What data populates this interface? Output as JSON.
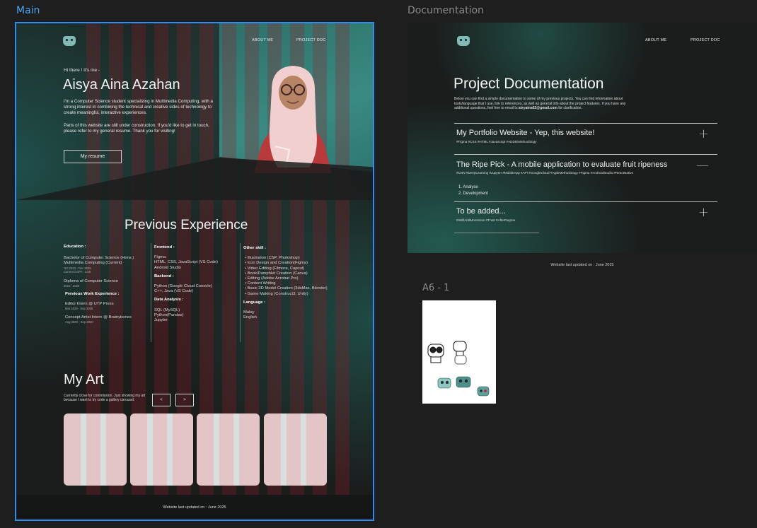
{
  "frames": {
    "main_label": "Main",
    "doc_label": "Documentation",
    "a6_label": "A6 - 1"
  },
  "main": {
    "nav": {
      "about": "ABOUT ME",
      "project": "PROJECT DOC"
    },
    "hero": {
      "greeting": "Hi there !  It's me -",
      "name": "Aisya Aina Azahan",
      "intro": "I'm a Computer Science student specializing in Multimedia Computing, with a strong interest in combining the technical and creative sides of technology to create meaningful, interactive experiences.",
      "construction": "Parts of this website are still under construction. If you'd like to get in touch, please refer to my general resume. Thank you for visiting!",
      "resume_button": "My resume"
    },
    "experience": {
      "heading": "Previous Experience",
      "education_label": "Education :",
      "edu1_title": "Bachelor of Computer Science (Hons.) Multimedia Computing (Current)",
      "edu1_date": "Oct 2023 - Dec 2025",
      "edu1_cgpa": "Current CGPA : 3.59",
      "edu2_title": "Diploma of Computer Science",
      "edu2_date": "2021 - 2023",
      "work_label": "Previous Work Experience :",
      "work1_title": "Editor Intern @ UTP Press",
      "work1_date": "Mar 2025 - Sep 2025",
      "work2_title": "Concept Artist Intern @ Brainybones",
      "work2_date": "Aug 2020 - Sep 2020",
      "frontend_label": "Frontend :",
      "frontend_items": "Figma\nHTML, CSS, JavaScript (VS Code)\nAndroid Studio",
      "backend_label": "Backend :",
      "backend_items": "Python (Google Cloud Console)\nC++, Java (VS Code)",
      "data_label": "Data Analysis :",
      "data_items": "SQL (MySQL)\nPython(Pandas)\nJupyter",
      "other_label": "Other skill :",
      "other_items": [
        "Illustration (CSP, Photoshop)",
        "Icon Design and Creation(Figma)",
        "Video Editing (Filmora, Capcut)",
        "Book/Pamphlet Creation (Canva)",
        "Editing (Adobe Acrobat Pro)",
        "Content Writing",
        "Basic 3D Model Creation (3dsMax, Blender)",
        "Game Making (Construct3, Unity)"
      ],
      "language_label": "Language :",
      "language_items": "Malay\nEnglish"
    },
    "art": {
      "heading": "My Art",
      "note": "Currently close for commission. Just showing my art because I want to try code a gallery carousel.",
      "prev_label": "<",
      "next_label": ">"
    },
    "footer": "Website last updated on : June 2025"
  },
  "doc": {
    "nav": {
      "about": "ABOUT ME",
      "project": "PROJECT DOC"
    },
    "title": "Project Documentation",
    "intro_text": "Below you can find a simple documentation to some of my previous projects. You can find information about tools/language that I use, link to references, as well as general info about the project features. If you have any additional questions, feel free to email to",
    "intro_email": "aisyaina02@gmail.com",
    "intro_end": "for clarification.",
    "items": [
      {
        "title": "My Portfolio Website - Yep, this website!",
        "tags": "#Figma #CSS #HTML #Javascript #ADDIEMethodology",
        "icon": "+"
      },
      {
        "title": "The Ripe Pick - A mobile application to evaluate fruit ripeness",
        "tags": "#CNN #DeepLearning #Jupyter #MobileApp #API #GoogleCloud #AgileMethodology #Figma #AndroidStudio #ReactNative",
        "icon": "—",
        "sub1": "1.  Analyse",
        "sub2": "2.  Development"
      },
      {
        "title": "To be added...",
        "tags": "#IWillAddMoreSoon #Trust #AfterDegree",
        "icon": "+"
      }
    ],
    "footer": "Website last updated on : June 2025"
  },
  "colors": {
    "accent": "#2d8ef0",
    "teal": "#3a8b82",
    "card": "#e3c4c7"
  }
}
